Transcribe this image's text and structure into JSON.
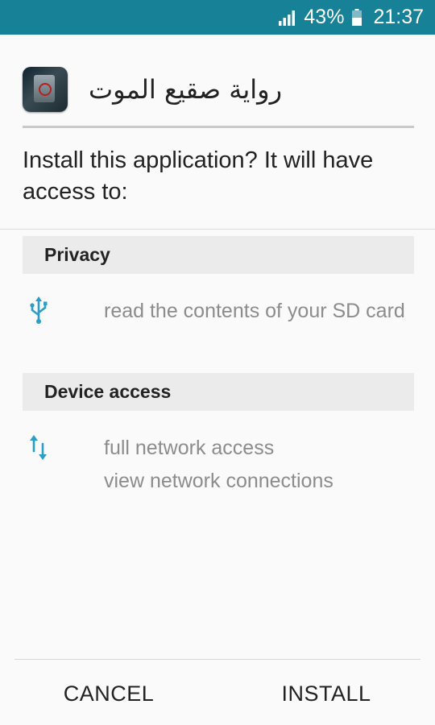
{
  "status_bar": {
    "battery": "43%",
    "time": "21:37",
    "bg_color": "#168197",
    "icons": [
      "signal-icon",
      "battery-icon"
    ]
  },
  "app": {
    "name": "رواية صقيع الموت",
    "icon": "app-icon"
  },
  "prompt": "Install this application? It will have access to:",
  "sections": [
    {
      "title": "Privacy",
      "icon": "usb-icon",
      "permissions": [
        "read the contents of your SD card"
      ]
    },
    {
      "title": "Device access",
      "icon": "network-arrows-icon",
      "permissions": [
        "full network access",
        "view network connections"
      ]
    }
  ],
  "buttons": {
    "cancel": "CANCEL",
    "install": "INSTALL"
  },
  "colors": {
    "accent": "#168197",
    "icon_blue": "#2a9ec8",
    "permission_text": "#8c8c8c"
  }
}
